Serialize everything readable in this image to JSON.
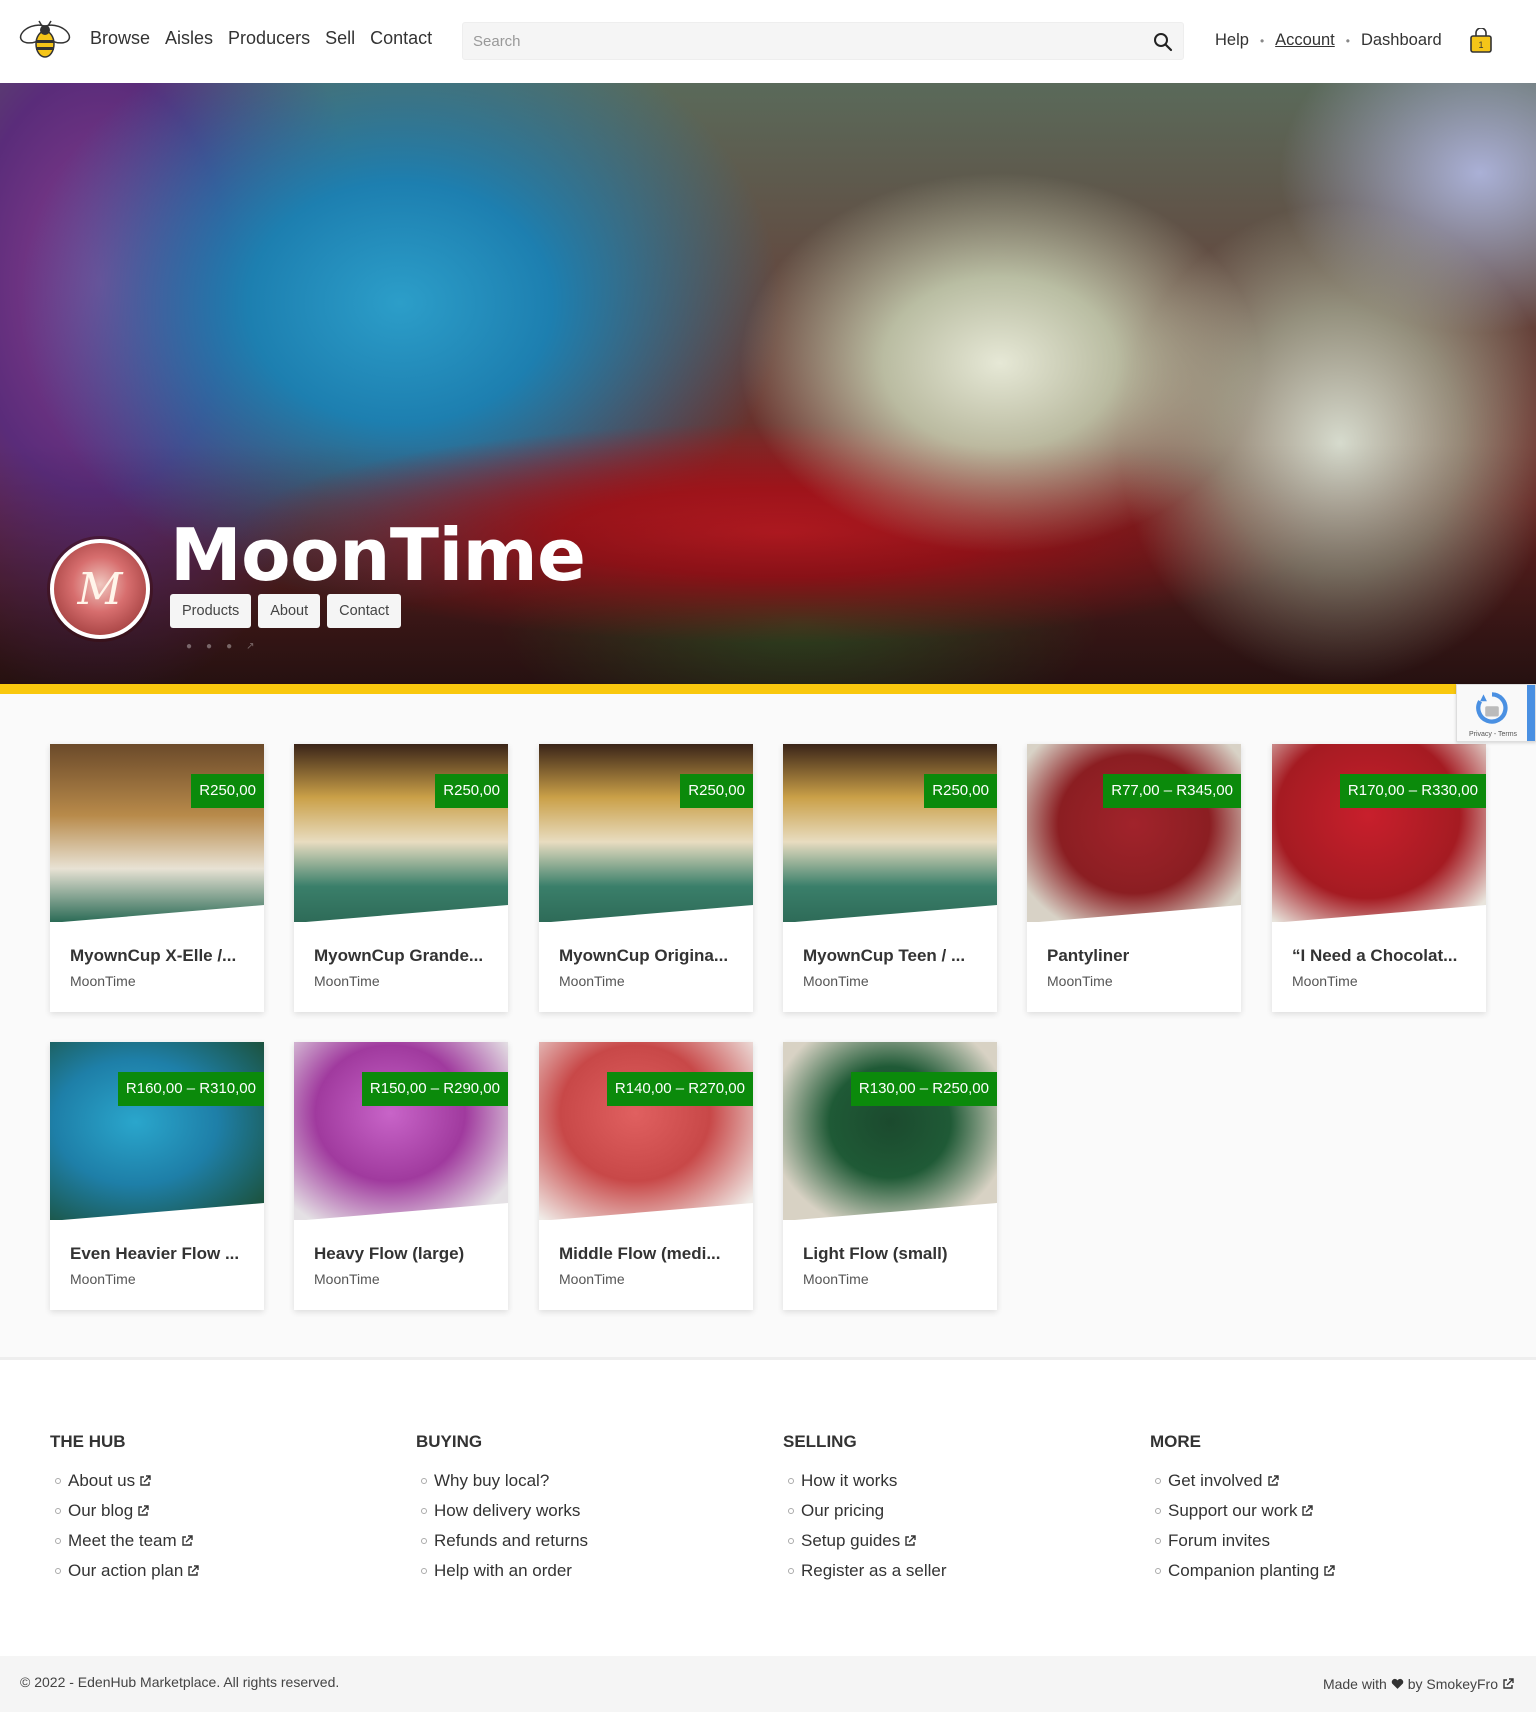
{
  "header": {
    "logo": "bee-logo-icon",
    "nav": [
      "Browse",
      "Aisles",
      "Producers",
      "Sell",
      "Contact"
    ],
    "search_placeholder": "Search",
    "links": {
      "help": "Help",
      "account": "Account",
      "dashboard": "Dashboard"
    },
    "basket_icon": "basket-icon",
    "basket_count": "1"
  },
  "store": {
    "name": "MoonTime",
    "avatar_letter": "M",
    "tabs": [
      "Products",
      "About",
      "Contact"
    ]
  },
  "recaptcha": {
    "text": "Privacy - Terms"
  },
  "accent_colors": {
    "yellow_bar": "#f9c80e",
    "price_badge": "#0b8a0b"
  },
  "products": [
    {
      "name": "MyownCup X-Elle /...",
      "seller": "MoonTime",
      "price": "R250,00"
    },
    {
      "name": "MyownCup Grande...",
      "seller": "MoonTime",
      "price": "R250,00"
    },
    {
      "name": "MyownCup Origina...",
      "seller": "MoonTime",
      "price": "R250,00"
    },
    {
      "name": "MyownCup Teen / ...",
      "seller": "MoonTime",
      "price": "R250,00"
    },
    {
      "name": "Pantyliner",
      "seller": "MoonTime",
      "price": "R77,00 – R345,00"
    },
    {
      "name": "“I Need a Chocolat...",
      "seller": "MoonTime",
      "price": "R170,00 – R330,00"
    },
    {
      "name": "Even Heavier Flow ...",
      "seller": "MoonTime",
      "price": "R160,00 – R310,00"
    },
    {
      "name": "Heavy Flow (large)",
      "seller": "MoonTime",
      "price": "R150,00 – R290,00"
    },
    {
      "name": "Middle Flow (medi...",
      "seller": "MoonTime",
      "price": "R140,00 – R270,00"
    },
    {
      "name": "Light Flow (small)",
      "seller": "MoonTime",
      "price": "R130,00 – R250,00"
    }
  ],
  "footer": {
    "columns": [
      {
        "title": "THE HUB",
        "links": [
          {
            "label": "About us",
            "external": true
          },
          {
            "label": "Our blog",
            "external": true
          },
          {
            "label": "Meet the team",
            "external": true
          },
          {
            "label": "Our action plan",
            "external": true
          }
        ]
      },
      {
        "title": "BUYING",
        "links": [
          {
            "label": "Why buy local?",
            "external": false
          },
          {
            "label": "How delivery works",
            "external": false
          },
          {
            "label": "Refunds and returns",
            "external": false
          },
          {
            "label": "Help with an order",
            "external": false
          }
        ]
      },
      {
        "title": "SELLING",
        "links": [
          {
            "label": "How it works",
            "external": false
          },
          {
            "label": "Our pricing",
            "external": false
          },
          {
            "label": "Setup guides",
            "external": true
          },
          {
            "label": "Register as a seller",
            "external": false
          }
        ]
      },
      {
        "title": "MORE",
        "links": [
          {
            "label": "Get involved",
            "external": true
          },
          {
            "label": "Support our work",
            "external": true
          },
          {
            "label": "Forum invites",
            "external": false
          },
          {
            "label": "Companion planting",
            "external": true
          }
        ]
      }
    ],
    "copyright": "© 2022 - EdenHub Marketplace. All rights reserved.",
    "made_with": {
      "prefix": "Made with",
      "suffix": "by SmokeyFro",
      "heart_icon": "heart-icon"
    }
  }
}
